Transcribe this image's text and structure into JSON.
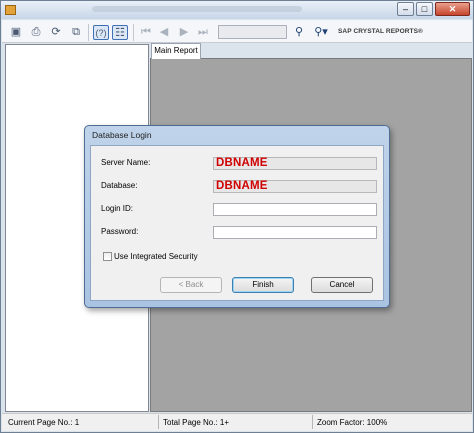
{
  "window": {
    "close_glyph": "✕",
    "min_glyph": "–",
    "max_glyph": "□"
  },
  "toolbar": {
    "icons": [
      "export-icon",
      "print-icon",
      "refresh-icon",
      "copy-icon",
      "help-icon",
      "toggle-tree-icon",
      "first-page-icon",
      "prev-page-icon",
      "next-page-icon",
      "last-page-icon",
      "find-icon",
      "zoom-icon"
    ],
    "brand": "SAP CRYSTAL REPORTS®"
  },
  "tab": {
    "label": "Main Report"
  },
  "dialog": {
    "title": "Database Login",
    "server_label": "Server Name:",
    "server_value": "DBNAME",
    "database_label": "Database:",
    "database_value": "DBNAME",
    "login_label": "Login ID:",
    "login_value": "",
    "password_label": "Password:",
    "password_value": "",
    "integrated_label": "Use Integrated Security",
    "integrated_checked": false,
    "back_label": "< Back",
    "finish_label": "Finish",
    "cancel_label": "Cancel"
  },
  "status": {
    "current_page": "Current Page No.: 1",
    "total_page": "Total Page No.: 1+",
    "zoom": "Zoom Factor: 100%"
  }
}
